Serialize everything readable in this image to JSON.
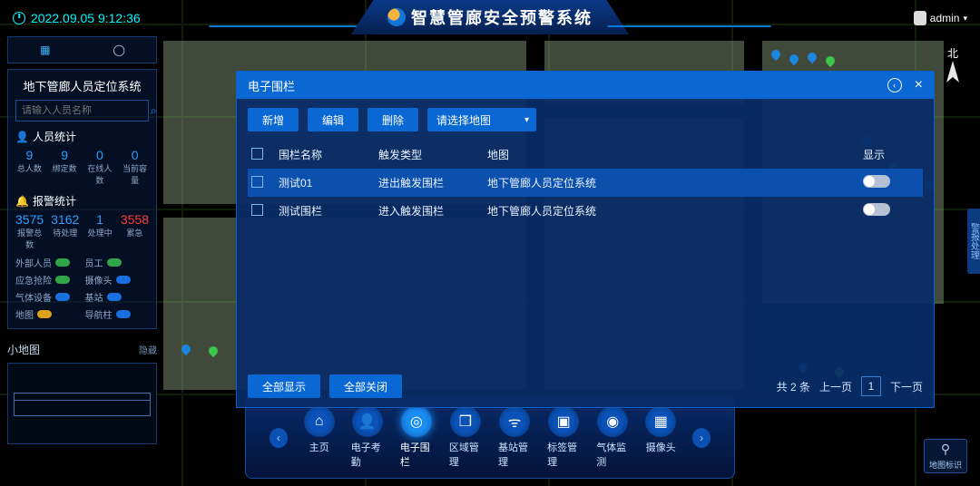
{
  "timestamp": "2022.09.05 9:12:36",
  "title": "智慧管廊安全预警系统",
  "user": {
    "name": "admin"
  },
  "compass": {
    "label": "北"
  },
  "sideRight": "警报处理",
  "mapMark": "地图标识",
  "sidebar": {
    "system_title": "地下管廊人员定位系统",
    "search_placeholder": "请输入人员名称",
    "personnel": {
      "title": "人员统计",
      "stats": [
        {
          "v": "9",
          "l": "总人数"
        },
        {
          "v": "9",
          "l": "绑定数"
        },
        {
          "v": "0",
          "l": "在线人数"
        },
        {
          "v": "0",
          "l": "当前容量"
        }
      ]
    },
    "alarm": {
      "title": "报警统计",
      "stats": [
        {
          "v": "3575",
          "l": "报警总数"
        },
        {
          "v": "3162",
          "l": "待处理"
        },
        {
          "v": "1",
          "l": "处理中"
        },
        {
          "v": "3558",
          "l": "累急"
        }
      ],
      "legend": [
        {
          "label": "外部人员",
          "c": "#2fa449"
        },
        {
          "label": "员工",
          "c": "#2fa449"
        },
        {
          "label": "应急抢险",
          "c": "#2fa449"
        },
        {
          "label": "摄像头",
          "c": "#1a6fe0"
        },
        {
          "label": "气体设备",
          "c": "#1a6fe0"
        },
        {
          "label": "基站",
          "c": "#1a6fe0"
        },
        {
          "label": "地图",
          "c": "#e0a11a"
        },
        {
          "label": "导航柱",
          "c": "#1a6fe0"
        }
      ]
    },
    "minimap": {
      "title": "小地图",
      "hide": "隐藏"
    }
  },
  "dock": {
    "items": [
      {
        "label": "主页",
        "icon": "home"
      },
      {
        "label": "电子考勤",
        "icon": "user"
      },
      {
        "label": "电子围栏",
        "icon": "target",
        "active": true
      },
      {
        "label": "区域管理",
        "icon": "layers"
      },
      {
        "label": "基站管理",
        "icon": "antenna"
      },
      {
        "label": "标签管理",
        "icon": "tag"
      },
      {
        "label": "气体监测",
        "icon": "gas"
      },
      {
        "label": "摄像头",
        "icon": "camera"
      }
    ]
  },
  "modal": {
    "title": "电子围栏",
    "toolbar": {
      "new": "新增",
      "edit": "编辑",
      "del": "删除",
      "select_placeholder": "请选择地图"
    },
    "columns": {
      "name": "围栏名称",
      "trigger": "触发类型",
      "map": "地图",
      "show": "显示"
    },
    "rows": [
      {
        "name": "测试01",
        "trigger": "进出触发围栏",
        "map": "地下管廊人员定位系统"
      },
      {
        "name": "测试围栏",
        "trigger": "进入触发围栏",
        "map": "地下管廊人员定位系统"
      }
    ],
    "footer": {
      "show_all": "全部显示",
      "close_all": "全部关闭",
      "total": "共 2 条",
      "prev": "上一页",
      "page": "1",
      "next": "下一页"
    }
  }
}
